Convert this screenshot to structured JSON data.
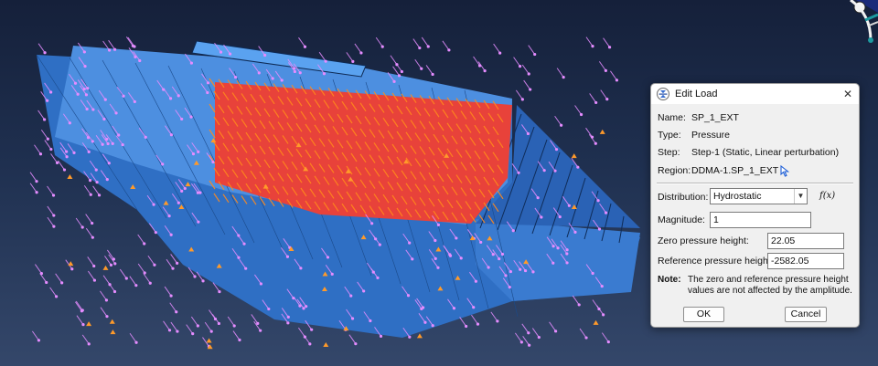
{
  "dialog": {
    "title": "Edit Load",
    "close_symbol": "✕",
    "name_label": "Name:",
    "name_value": "SP_1_EXT",
    "type_label": "Type:",
    "type_value": "Pressure",
    "step_label": "Step:",
    "step_value": "Step-1 (Static, Linear perturbation)",
    "region_label": "Region:",
    "region_value": "DDMA-1.SP_1_EXT",
    "distribution_label": "Distribution:",
    "distribution_value": "Hydrostatic",
    "fx_label": "f(x)",
    "magnitude_label": "Magnitude:",
    "magnitude_value": "1",
    "zero_height_label": "Zero pressure height:",
    "zero_height_value": "22.05",
    "ref_height_label": "Reference pressure height:",
    "ref_height_value": "-2582.05",
    "note_label": "Note:",
    "note_text": "The zero and reference pressure height values are not affected by the amplitude.",
    "ok_label": "OK",
    "cancel_label": "Cancel"
  },
  "icons": {
    "title_icon": "edit-load-icon",
    "region_cursor": "arrow-cursor-icon",
    "close": "close-icon",
    "dropdown": "chevron-down-icon",
    "triad": "view-triad-icon"
  },
  "colors": {
    "background_top": "#15203a",
    "background_bottom": "#34476a",
    "model_blue": "#2f6fc4",
    "model_light_blue": "#4d8fe0",
    "pressure_arrow_violet": "#e58cff",
    "highlight_red": "#e8423a",
    "highlight_orange": "#ff8a1c"
  }
}
